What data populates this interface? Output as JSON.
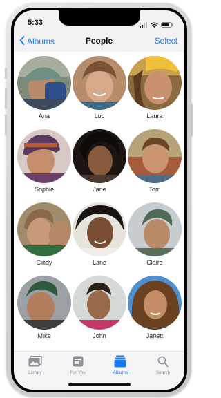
{
  "status_bar": {
    "time": "5:33",
    "icons": [
      "cellular-signal-icon",
      "wifi-icon",
      "battery-icon"
    ]
  },
  "nav": {
    "back_label": "Albums",
    "title": "People",
    "select_label": "Select"
  },
  "people": [
    {
      "name": "Ana"
    },
    {
      "name": "Luc"
    },
    {
      "name": "Laura"
    },
    {
      "name": "Sophie"
    },
    {
      "name": "Jane"
    },
    {
      "name": "Tom"
    },
    {
      "name": "Cindy"
    },
    {
      "name": "Lane"
    },
    {
      "name": "Claire"
    },
    {
      "name": "Mike"
    },
    {
      "name": "John"
    },
    {
      "name": "Janett"
    }
  ],
  "tabs": [
    {
      "label": "Library",
      "icon": "photo-library-icon"
    },
    {
      "label": "For You",
      "icon": "for-you-icon"
    },
    {
      "label": "Albums",
      "icon": "albums-icon",
      "active": true
    },
    {
      "label": "Search",
      "icon": "search-icon"
    }
  ],
  "colors": {
    "accent": "#1a7cf5",
    "inactive_tab": "#8e8e93",
    "bar_background": "#f2f2f4"
  }
}
